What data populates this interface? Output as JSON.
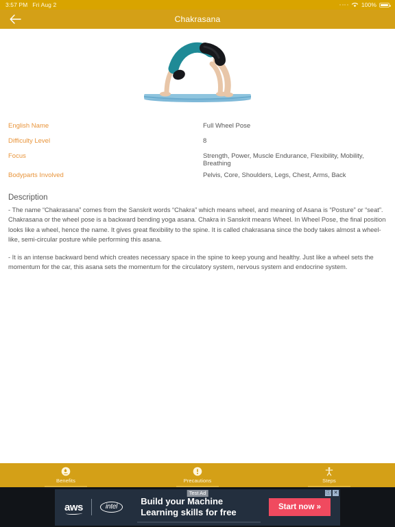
{
  "statusbar": {
    "time": "3:57 PM",
    "date": "Fri Aug 2",
    "battery_percent": "100%",
    "wifi_icon": "wifi-icon",
    "battery_icon": "battery-icon"
  },
  "appbar": {
    "title": "Chakrasana",
    "back_icon": "back-arrow-icon"
  },
  "hero": {
    "image_alt": "chakrasana-pose-illustration"
  },
  "details": [
    {
      "label": "English Name",
      "value": "Full Wheel Pose"
    },
    {
      "label": "Difficulty Level",
      "value": "8"
    },
    {
      "label": "Focus",
      "value": "Strength, Power, Muscle Endurance, Flexibility, Mobility, Breathing"
    },
    {
      "label": "Bodyparts Involved",
      "value": "Pelvis, Core, Shoulders, Legs, Chest, Arms, Back"
    }
  ],
  "description": {
    "title": "Description",
    "paragraphs": [
      "- The name “Chakrasana” comes from the Sanskrit words “Chakra” which means wheel, and meaning of Asana is “Posture” or “seat”. Chakrasana or the wheel pose is a backward bending yoga asana. Chakra in Sanskrit means Wheel. In Wheel Pose, the final position looks like a wheel, hence the name. It gives great flexibility to the spine. It is called chakrasana since the body takes almost a wheel-like, semi-circular posture while performing this asana.",
      " -  It is an intense backward bend which creates necessary space in the spine to keep young and healthy. Just like a wheel sets the momentum for the car, this asana sets the momentum for the circulatory system, nervous system and endocrine system."
    ]
  },
  "tabs": [
    {
      "label": "Benefits",
      "icon": "thumbs-up-circle-icon"
    },
    {
      "label": "Precautions",
      "icon": "warning-circle-icon"
    },
    {
      "label": "Steps",
      "icon": "standing-person-icon"
    }
  ],
  "ad": {
    "test_label": "Test Ad",
    "brand_primary": "aws",
    "brand_secondary": "intel",
    "headline_line1": "Build your Machine",
    "headline_line2": "Learning skills for free",
    "cta": "Start now »",
    "adchoices_icon": "adchoices-icon",
    "close_icon": "close-icon"
  },
  "colors": {
    "appbar": "#D4A017",
    "statusbar": "#D9A400",
    "label_orange": "#E8943A",
    "body_text": "#555555",
    "ad_background": "#232F3E",
    "ad_cta": "#F04A5F"
  }
}
